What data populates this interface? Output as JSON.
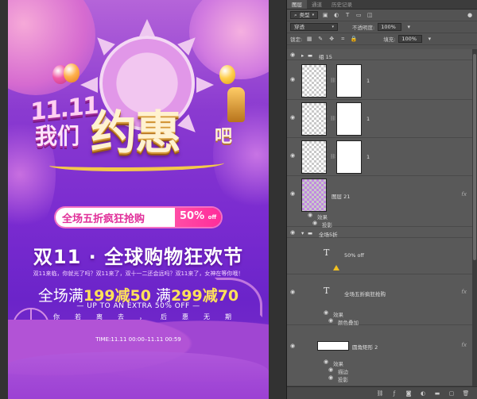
{
  "poster": {
    "title_top": "11.11",
    "title_we": "我们",
    "title_main": "约惠",
    "title_ba": "吧",
    "promo_label": "全场五折疯狂抢购",
    "promo_pct": "50%",
    "promo_off": "off",
    "headline": "双11 · 全球购物狂欢节",
    "subline": "双11来临，你就光了吗？双11来了，双十一二还会远吗？双11来了，女神在等你哦！",
    "deal_prefix1": "全场满",
    "deal_num1": "199减50",
    "deal_prefix2": " 满",
    "deal_num2": "299减70",
    "extra": "— UP TO AN EXTRA 50% OFF —",
    "chars": [
      "你",
      "若",
      "离",
      "去",
      "，",
      "后",
      "惠",
      "无",
      "期"
    ],
    "time": "TIME:11.11 00:00–11.11 00:59"
  },
  "panel": {
    "tabs": [
      "图层",
      "通道",
      "历史记录"
    ],
    "filter_type": "类型",
    "blend_mode": "穿透",
    "opacity_label": "不透明度:",
    "opacity_value": "100%",
    "lock_label": "锁定:",
    "fill_label": "填充:",
    "fill_value": "100%",
    "group15": "组 15",
    "layer_num": "1",
    "layer21": "图层 21",
    "effects": "效果",
    "shadow": "投影",
    "group_full": "全场5折",
    "text_50off": "50% off",
    "text_promo": "全场五折疯狂抢购",
    "color_overlay": "颜色叠加",
    "rect_name": "圆角矩形 2",
    "stroke": "描边",
    "fx": "fx"
  }
}
